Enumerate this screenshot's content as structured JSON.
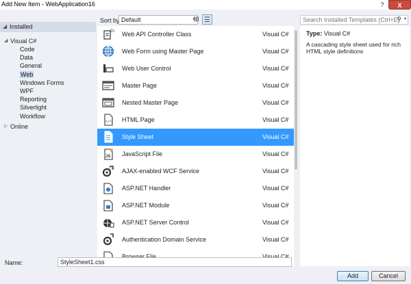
{
  "window": {
    "title": "Add New Item - WebApplication16",
    "help_label": "?",
    "close_label": "X"
  },
  "tree": {
    "header_arrow": "◢",
    "header_label": "Installed",
    "visual_csharp_toggle": "◢",
    "visual_csharp": "Visual C#",
    "children": [
      "Code",
      "Data",
      "General",
      "Web",
      "Windows Forms",
      "WPF",
      "Reporting",
      "Silverlight",
      "Workflow"
    ],
    "selected": "Web",
    "online_toggle": "▷",
    "online": "Online"
  },
  "toolbar": {
    "sort_label": "Sort by:",
    "sort_value": "Default",
    "sort_arrow": "▾",
    "grid_view_icon": "⊞",
    "list_view_icon": "☰"
  },
  "templates": [
    {
      "name": "Web API Controller Class",
      "lang": "Visual C#",
      "icon": "cs-class-icon"
    },
    {
      "name": "Web Form using Master Page",
      "lang": "Visual C#",
      "icon": "globe-icon"
    },
    {
      "name": "Web User Control",
      "lang": "Visual C#",
      "icon": "user-control-icon"
    },
    {
      "name": "Master Page",
      "lang": "Visual C#",
      "icon": "master-page-icon"
    },
    {
      "name": "Nested Master Page",
      "lang": "Visual C#",
      "icon": "nested-master-page-icon"
    },
    {
      "name": "HTML Page",
      "lang": "Visual C#",
      "icon": "html-page-icon"
    },
    {
      "name": "Style Sheet",
      "lang": "Visual C#",
      "icon": "style-sheet-icon"
    },
    {
      "name": "JavaScript File",
      "lang": "Visual C#",
      "icon": "javascript-file-icon"
    },
    {
      "name": "AJAX-enabled WCF Service",
      "lang": "Visual C#",
      "icon": "wcf-service-icon"
    },
    {
      "name": "ASP.NET Handler",
      "lang": "Visual C#",
      "icon": "handler-icon"
    },
    {
      "name": "ASP.NET Module",
      "lang": "Visual C#",
      "icon": "module-icon"
    },
    {
      "name": "ASP.NET Server Control",
      "lang": "Visual C#",
      "icon": "server-control-icon"
    },
    {
      "name": "Authentication Domain Service",
      "lang": "Visual C#",
      "icon": "domain-service-icon"
    },
    {
      "name": "Browser File",
      "lang": "Visual C#",
      "icon": "browser-file-icon"
    }
  ],
  "selected_template": "Style Sheet",
  "search": {
    "placeholder": "Search Installed Templates (Ctrl+E)",
    "icon": "⚲",
    "dropdown": "▾"
  },
  "details": {
    "type_label": "Type:",
    "type_value": "Visual C#",
    "description": "A cascading style sheet used for rich HTML style definitions"
  },
  "name_field": {
    "label": "Name:",
    "value": "StyleSheet1.css"
  },
  "buttons": {
    "add": "Add",
    "cancel": "Cancel"
  },
  "colors": {
    "selection": "#3399ff",
    "tree_header": "#d6dbe9",
    "frame": "#eef0f5",
    "close_button": "#c94a3e"
  }
}
